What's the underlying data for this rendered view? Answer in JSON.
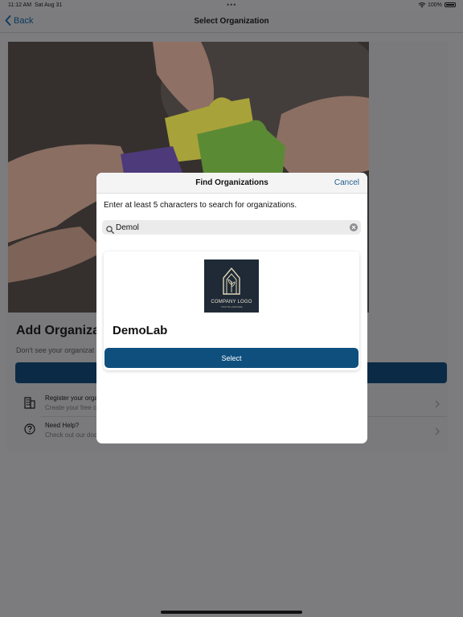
{
  "status_bar": {
    "time": "11:12 AM",
    "date": "Sat Aug 31",
    "multitask_dots": "•••",
    "battery": "100%"
  },
  "nav": {
    "back_label": "Back",
    "title": "Select Organization"
  },
  "background": {
    "heading": "Add Organiza",
    "subtext": "Don't see your organizat",
    "rows": [
      {
        "title": "Register your orga",
        "subtitle": "Create your free c"
      },
      {
        "title": "Need Help?",
        "subtitle": "Check out our doc"
      }
    ]
  },
  "modal": {
    "title": "Find Organizations",
    "cancel_label": "Cancel",
    "instruction": "Enter at least 5 characters to search for organizations.",
    "search": {
      "value": "Demol",
      "placeholder": ""
    },
    "result": {
      "logo_text": "COMPANY LOGO",
      "logo_tagline": "YOUR TAG LINE HERE",
      "name": "DemoLab",
      "select_label": "Select"
    }
  },
  "colors": {
    "accent": "#0f4f7e",
    "link": "#1f5f8b",
    "overlay": "#7c7c7e",
    "logo_bg": "#1f2a36"
  }
}
